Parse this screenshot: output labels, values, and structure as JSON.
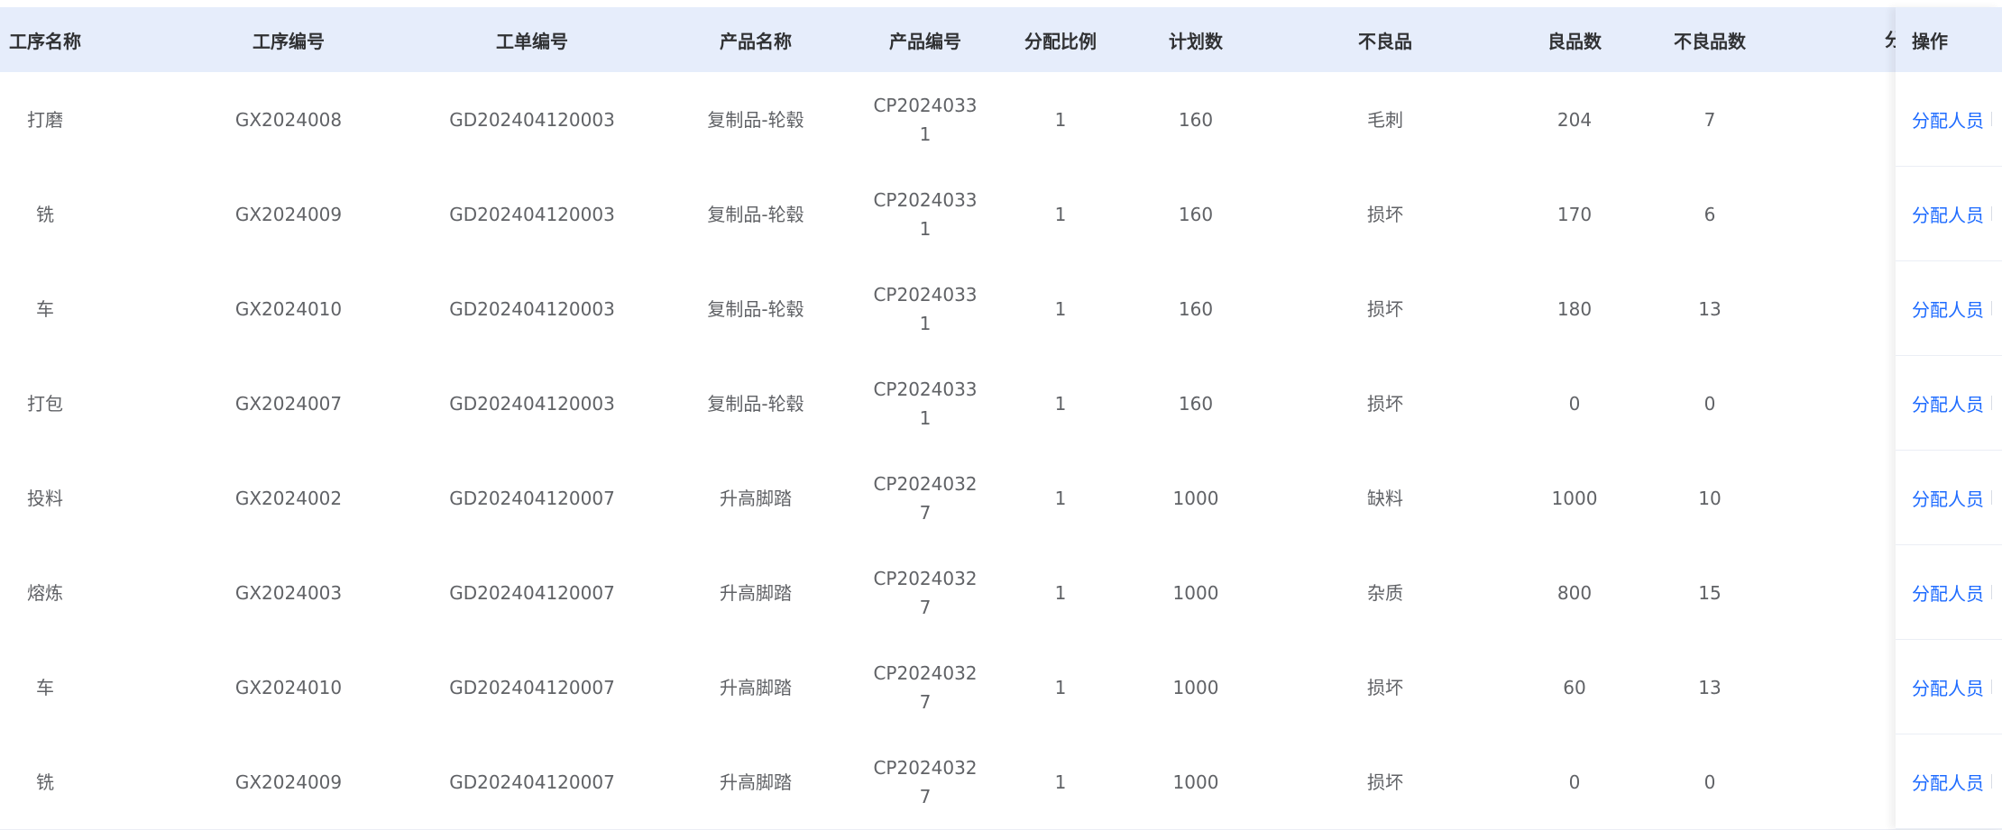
{
  "columns": [
    "工序名称",
    "工序编号",
    "工单编号",
    "产品名称",
    "产品编号",
    "分配比例",
    "计划数",
    "不良品",
    "良品数",
    "不良品数"
  ],
  "clipped_column": "分",
  "operation_header": "操作",
  "operation_link": "分配人员",
  "rows": [
    [
      "打磨",
      "GX2024008",
      "GD202404120003",
      "复制品-轮毂",
      "CP20240331",
      "1",
      "160",
      "毛刺",
      "204",
      "7"
    ],
    [
      "铣",
      "GX2024009",
      "GD202404120003",
      "复制品-轮毂",
      "CP20240331",
      "1",
      "160",
      "损坏",
      "170",
      "6"
    ],
    [
      "车",
      "GX2024010",
      "GD202404120003",
      "复制品-轮毂",
      "CP20240331",
      "1",
      "160",
      "损坏",
      "180",
      "13"
    ],
    [
      "打包",
      "GX2024007",
      "GD202404120003",
      "复制品-轮毂",
      "CP20240331",
      "1",
      "160",
      "损坏",
      "0",
      "0"
    ],
    [
      "投料",
      "GX2024002",
      "GD202404120007",
      "升高脚踏",
      "CP20240327",
      "1",
      "1000",
      "缺料",
      "1000",
      "10"
    ],
    [
      "熔炼",
      "GX2024003",
      "GD202404120007",
      "升高脚踏",
      "CP20240327",
      "1",
      "1000",
      "杂质",
      "800",
      "15"
    ],
    [
      "车",
      "GX2024010",
      "GD202404120007",
      "升高脚踏",
      "CP20240327",
      "1",
      "1000",
      "损坏",
      "60",
      "13"
    ],
    [
      "铣",
      "GX2024009",
      "GD202404120007",
      "升高脚踏",
      "CP20240327",
      "1",
      "1000",
      "损坏",
      "0",
      "0"
    ]
  ]
}
